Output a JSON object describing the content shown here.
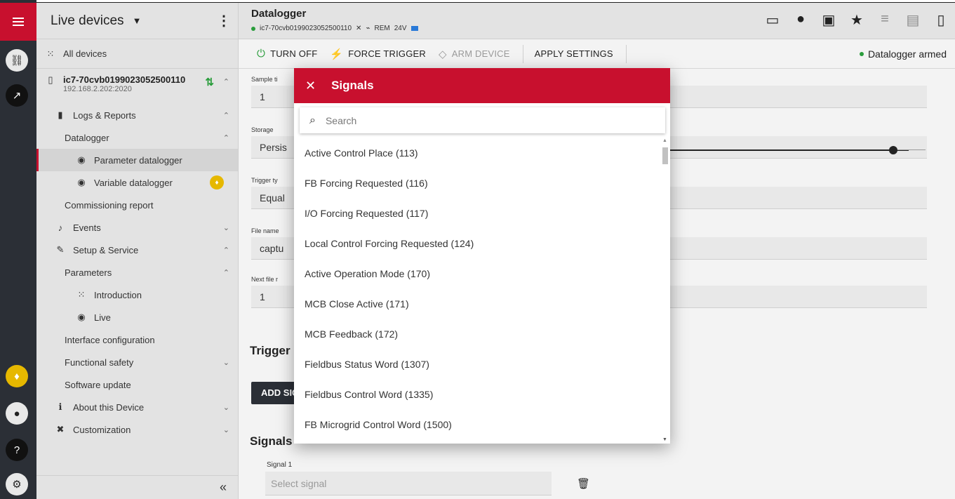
{
  "header": {
    "title": "Datalogger",
    "device_id": "ic7-70cvb0199023052500110",
    "rem_label": "REM",
    "voltage": "24V"
  },
  "sidebar": {
    "title": "Live devices",
    "all_devices": "All devices",
    "device_name": "ic7-70cvb0199023052500110",
    "device_ip": "192.168.2.202:2020",
    "items": [
      {
        "label": "Logs & Reports"
      },
      {
        "label": "Datalogger"
      },
      {
        "label": "Parameter datalogger"
      },
      {
        "label": "Variable datalogger"
      },
      {
        "label": "Commissioning report"
      },
      {
        "label": "Events"
      },
      {
        "label": "Setup & Service"
      },
      {
        "label": "Parameters"
      },
      {
        "label": "Introduction"
      },
      {
        "label": "Live"
      },
      {
        "label": "Interface configuration"
      },
      {
        "label": "Functional safety"
      },
      {
        "label": "Software update"
      },
      {
        "label": "About this Device"
      },
      {
        "label": "Customization"
      }
    ],
    "collapse": "«"
  },
  "toolbar": {
    "turn_off": "TURN OFF",
    "force_trigger": "FORCE TRIGGER",
    "arm_device": "ARM DEVICE",
    "apply_settings": "APPLY SETTINGS",
    "status": "Datalogger armed"
  },
  "form": {
    "sample_label": "Sample ti",
    "sample_value": "1",
    "storage_label": "Storage",
    "storage_value": "Persis",
    "trigger_type_label": "Trigger ty",
    "trigger_type_value": "Equal",
    "file_name_label": "File name",
    "file_name_value": "captu",
    "next_file_label": "Next file r",
    "next_file_value": "1",
    "trigger_section": "Trigger :",
    "add_signal": "ADD SIG",
    "signals_section": "Signals",
    "signal1_label": "Signal 1",
    "signal1_placeholder": "Select signal"
  },
  "dialog": {
    "title": "Signals",
    "close": "✕",
    "search_placeholder": "Search",
    "items": [
      "Active Control Place (113)",
      "FB Forcing Requested (116)",
      "I/O Forcing Requested (117)",
      "Local Control Forcing Requested (124)",
      "Active Operation Mode (170)",
      "MCB Close Active (171)",
      "MCB Feedback (172)",
      "Fieldbus Status Word (1307)",
      "Fieldbus Control Word (1335)",
      "FB Microgrid Control Word (1500)"
    ]
  }
}
